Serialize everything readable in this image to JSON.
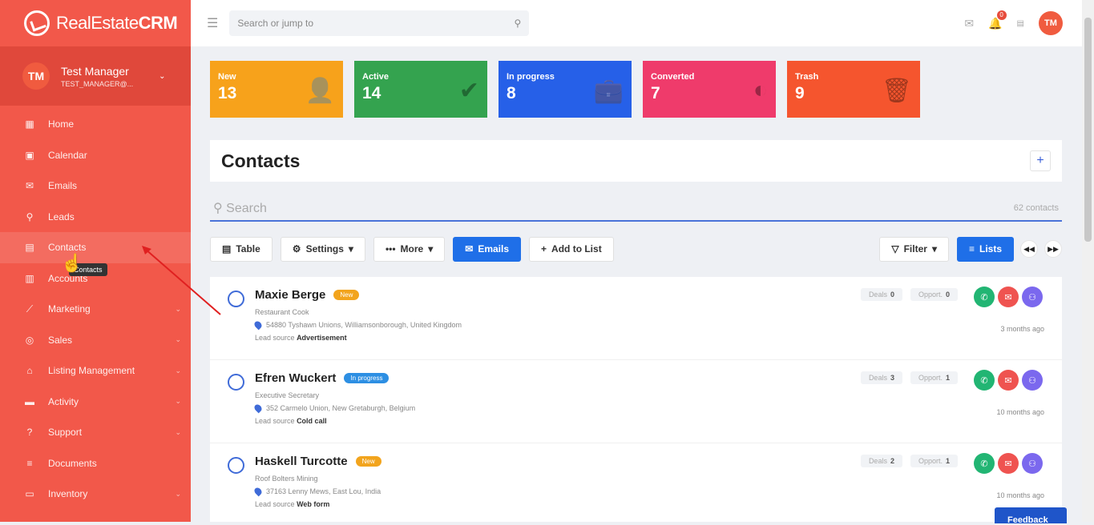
{
  "app": {
    "logo_text_a": "RealEstate",
    "logo_text_b": "CRM"
  },
  "user": {
    "initials": "TM",
    "name": "Test Manager",
    "email": "TEST_MANAGER@..."
  },
  "nav": [
    {
      "label": "Home",
      "icon": "grid-icon",
      "glyph": "▦",
      "has_sub": false
    },
    {
      "label": "Calendar",
      "icon": "calendar-icon",
      "glyph": "▣",
      "has_sub": false
    },
    {
      "label": "Emails",
      "icon": "mail-icon",
      "glyph": "✉",
      "has_sub": false
    },
    {
      "label": "Leads",
      "icon": "search-icon",
      "glyph": "⚲",
      "has_sub": false
    },
    {
      "label": "Contacts",
      "icon": "contacts-icon",
      "glyph": "▤",
      "has_sub": false
    },
    {
      "label": "Accounts",
      "icon": "building-icon",
      "glyph": "▥",
      "has_sub": false
    },
    {
      "label": "Marketing",
      "icon": "trend-icon",
      "glyph": "⟋",
      "has_sub": true
    },
    {
      "label": "Sales",
      "icon": "target-icon",
      "glyph": "◎",
      "has_sub": true
    },
    {
      "label": "Listing Management",
      "icon": "house-icon",
      "glyph": "⌂",
      "has_sub": true
    },
    {
      "label": "Activity",
      "icon": "briefcase-icon",
      "glyph": "▬",
      "has_sub": true
    },
    {
      "label": "Support",
      "icon": "support-icon",
      "glyph": "?",
      "has_sub": true
    },
    {
      "label": "Documents",
      "icon": "list-icon",
      "glyph": "≡",
      "has_sub": false
    },
    {
      "label": "Inventory",
      "icon": "monitor-icon",
      "glyph": "▭",
      "has_sub": true
    }
  ],
  "tooltip": "Contacts",
  "topbar": {
    "search_placeholder": "Search or jump to",
    "notif_count": "0",
    "avatar": "TM"
  },
  "stats": [
    {
      "label": "New",
      "value": "13",
      "color": "#f7a21b",
      "icon": "person-icon",
      "glyph": "👤"
    },
    {
      "label": "Active",
      "value": "14",
      "color": "#34a34f",
      "icon": "check-icon",
      "glyph": "✔"
    },
    {
      "label": "In progress",
      "value": "8",
      "color": "#2660e8",
      "icon": "briefcase-icon",
      "glyph": "💼"
    },
    {
      "label": "Converted",
      "value": "7",
      "color": "#ef3b6b",
      "icon": "half-circle-icon",
      "glyph": "◐"
    },
    {
      "label": "Trash",
      "value": "9",
      "color": "#f5552e",
      "icon": "trash-icon",
      "glyph": "🗑"
    }
  ],
  "contacts": {
    "title": "Contacts",
    "search_placeholder": "Search",
    "count_text": "62 contacts",
    "toolbar": {
      "table": "Table",
      "settings": "Settings",
      "more": "More",
      "emails": "Emails",
      "add_to_list": "Add to List",
      "filter": "Filter",
      "lists": "Lists"
    },
    "rows": [
      {
        "name": "Maxie Berge",
        "tag": "New",
        "tag_color": "#f2a41d",
        "job": "Restaurant Cook",
        "address": "54880 Tyshawn Unions, Williamsonborough, United Kingdom",
        "source_label": "Lead source",
        "source": "Advertisement",
        "deals_label": "Deals",
        "deals": "0",
        "opps_label": "Opport.",
        "opps": "0",
        "ago": "3 months ago"
      },
      {
        "name": "Efren Wuckert",
        "tag": "In progress",
        "tag_color": "#2d8fe3",
        "job": "Executive Secretary",
        "address": "352 Carmelo Union, New Gretaburgh, Belgium",
        "source_label": "Lead source",
        "source": "Cold call",
        "deals_label": "Deals",
        "deals": "3",
        "opps_label": "Opport.",
        "opps": "1",
        "ago": "10 months ago"
      },
      {
        "name": "Haskell Turcotte",
        "tag": "New",
        "tag_color": "#f2a41d",
        "job": "Roof Bolters Mining",
        "address": "37163 Lenny Mews, East Lou, India",
        "source_label": "Lead source",
        "source": "Web form",
        "deals_label": "Deals",
        "deals": "2",
        "opps_label": "Opport.",
        "opps": "1",
        "ago": "10 months ago"
      }
    ]
  },
  "feedback": "Feedback"
}
